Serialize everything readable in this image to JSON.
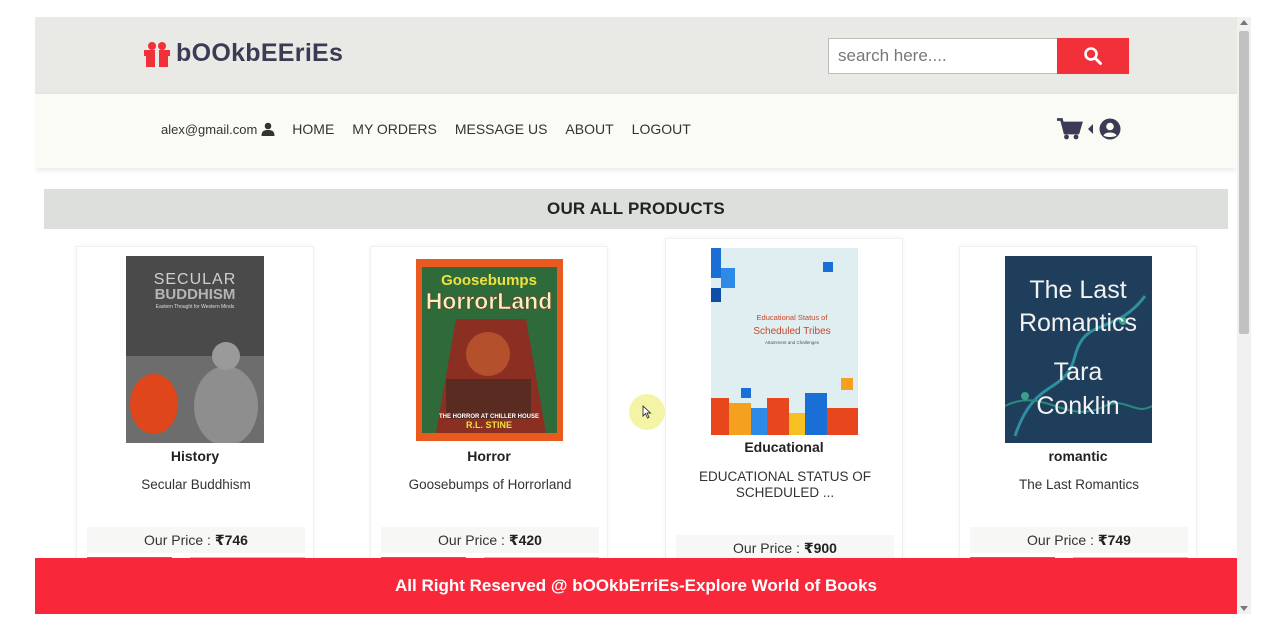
{
  "brand": {
    "name": "bOOkbEEriEs"
  },
  "search": {
    "placeholder": "search here....",
    "icon": "search-icon"
  },
  "nav": {
    "email": "alex@gmail.com",
    "links": [
      "HOME",
      "MY ORDERS",
      "MESSAGE US",
      "ABOUT",
      "LOGOUT"
    ]
  },
  "section": {
    "title": "OUR ALL PRODUCTS"
  },
  "products": [
    {
      "category": "History",
      "title": "Secular Buddhism",
      "price_label": "Our Price :",
      "price": "₹746",
      "cover_text": [
        "SECULAR",
        "BUDDHISM",
        "Eastern Thought for Western Minds"
      ]
    },
    {
      "category": "Horror",
      "title": "Goosebumps of Horrorland",
      "price_label": "Our Price :",
      "price": "₹420",
      "cover_text": [
        "Goosebumps",
        "HorrorLand",
        "THE HORROR AT CHILLER HOUSE",
        "R.L. STINE"
      ]
    },
    {
      "category": "Educational",
      "title": "EDUCATIONAL STATUS OF SCHEDULED ...",
      "price_label": "Our Price :",
      "price": "₹900",
      "cover_text": [
        "Educational Status of",
        "Scheduled Tribes",
        "Attainment and Challenges"
      ]
    },
    {
      "category": "romantic",
      "title": "The Last Romantics",
      "price_label": "Our Price :",
      "price": "₹749",
      "cover_text": [
        "The Last",
        "Romantics",
        "Tara",
        "Conklin"
      ]
    }
  ],
  "footer": {
    "text": "All Right Reserved @ bOOkbErriEs-Explore World of Books"
  },
  "colors": {
    "accent": "#f2303a",
    "footer": "#f8283a",
    "brand_text": "#3b3b55",
    "header_bg": "#e9e9e6"
  }
}
